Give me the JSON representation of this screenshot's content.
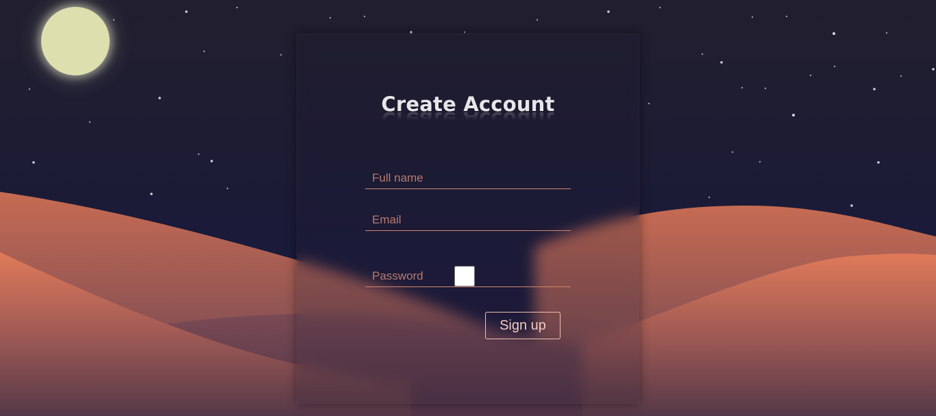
{
  "page": {
    "title": "Create Account"
  },
  "form": {
    "full_name": {
      "placeholder": "Full name",
      "value": ""
    },
    "email": {
      "placeholder": "Email",
      "value": ""
    },
    "password": {
      "placeholder": "Password",
      "value": "",
      "show_password_checked": false
    },
    "submit_label": "Sign up"
  },
  "colors": {
    "sky": "#1d1c33",
    "moon": "#dedfae",
    "dune_light": "#dd7758",
    "dune_dark": "#5a3a4b",
    "field_underline": "#d2876c",
    "placeholder": "#b87a6e",
    "button_border": "#f2c2b2"
  },
  "icons": [
    "moon-icon",
    "star-icon"
  ]
}
